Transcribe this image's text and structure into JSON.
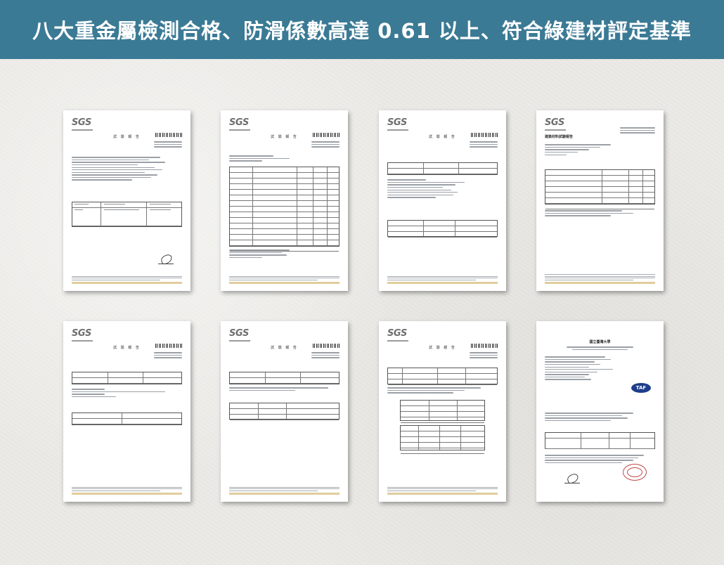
{
  "banner": {
    "title": "八大重金屬檢測合格、防滑係數高達 0.61 以上、符合綠建材評定基準"
  },
  "documents": [
    {
      "logo": "SGS",
      "heading": "試 驗 報 告"
    },
    {
      "logo": "SGS",
      "heading": "試 驗 報 告"
    },
    {
      "logo": "SGS",
      "heading": "試 驗 報 告"
    },
    {
      "logo": "SGS",
      "heading": "建築材料試驗報告"
    },
    {
      "logo": "SGS",
      "heading": "試 驗 報 告"
    },
    {
      "logo": "SGS",
      "heading": "試 驗 報 告"
    },
    {
      "logo": "SGS",
      "heading": "試 驗 報 告"
    },
    {
      "logo": "",
      "heading": "國立臺灣大學"
    }
  ]
}
